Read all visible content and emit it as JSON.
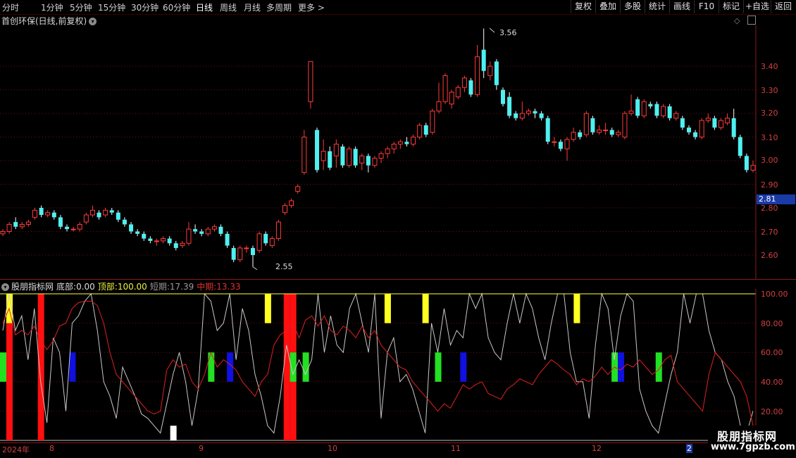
{
  "toolbar": {
    "periods": [
      "分时",
      "1分钟",
      "5分钟",
      "15分钟",
      "30分钟",
      "60分钟",
      "日线",
      "周线",
      "月线",
      "多周期",
      "更多 >"
    ],
    "active_period": "日线",
    "buttons": [
      "复权",
      "叠加",
      "多股",
      "统计",
      "画线",
      "F10",
      "标记",
      "+自选",
      "返回"
    ]
  },
  "main_chart": {
    "title": "首创环保(日线,前复权)",
    "y_ticks": [
      "3.40",
      "3.30",
      "3.20",
      "3.10",
      "3.00",
      "2.90",
      "2.80",
      "2.70",
      "2.60"
    ],
    "current_price": "2.81",
    "high_label": "3.56",
    "low_label": "2.55"
  },
  "indicator": {
    "name": "股朋指标网",
    "bottom_label": "底部:",
    "bottom_value": "0.00",
    "top_label": "顶部:",
    "top_value": "100.00",
    "short_label": "短期:",
    "short_value": "17.39",
    "mid_label": "中期:",
    "mid_value": "13.33",
    "y_ticks": [
      "100.00",
      "80.00",
      "60.00",
      "40.00",
      "20.00"
    ]
  },
  "x_axis": {
    "labels": [
      "2024年",
      "8",
      "9",
      "10",
      "11",
      "12",
      "2"
    ]
  },
  "watermark": {
    "line1": "股朋指标网",
    "line2": "www.7gpzb.com"
  },
  "colors": {
    "up": "#ff3b3b",
    "down": "#4ff0f0",
    "grid": "#8a1a1a",
    "top_line": "#ffff40",
    "short_line": "#c8c8c8",
    "mid_line": "#e02020"
  },
  "chart_data": {
    "type": "candlestick",
    "title": "首创环保(日线,前复权)",
    "ylim": [
      2.52,
      3.6
    ],
    "candles": [
      {
        "o": 2.69,
        "c": 2.7,
        "h": 2.71,
        "l": 2.68
      },
      {
        "o": 2.7,
        "c": 2.73,
        "h": 2.74,
        "l": 2.69
      },
      {
        "o": 2.74,
        "c": 2.72,
        "h": 2.76,
        "l": 2.71
      },
      {
        "o": 2.72,
        "c": 2.73,
        "h": 2.74,
        "l": 2.71
      },
      {
        "o": 2.73,
        "c": 2.74,
        "h": 2.75,
        "l": 2.72
      },
      {
        "o": 2.76,
        "c": 2.79,
        "h": 2.8,
        "l": 2.75
      },
      {
        "o": 2.8,
        "c": 2.77,
        "h": 2.81,
        "l": 2.76
      },
      {
        "o": 2.77,
        "c": 2.78,
        "h": 2.79,
        "l": 2.76
      },
      {
        "o": 2.78,
        "c": 2.76,
        "h": 2.79,
        "l": 2.75
      },
      {
        "o": 2.76,
        "c": 2.72,
        "h": 2.77,
        "l": 2.71
      },
      {
        "o": 2.72,
        "c": 2.71,
        "h": 2.73,
        "l": 2.7
      },
      {
        "o": 2.71,
        "c": 2.71,
        "h": 2.72,
        "l": 2.7
      },
      {
        "o": 2.71,
        "c": 2.73,
        "h": 2.74,
        "l": 2.7
      },
      {
        "o": 2.74,
        "c": 2.77,
        "h": 2.78,
        "l": 2.73
      },
      {
        "o": 2.77,
        "c": 2.79,
        "h": 2.81,
        "l": 2.76
      },
      {
        "o": 2.78,
        "c": 2.76,
        "h": 2.79,
        "l": 2.75
      },
      {
        "o": 2.77,
        "c": 2.79,
        "h": 2.8,
        "l": 2.76
      },
      {
        "o": 2.79,
        "c": 2.78,
        "h": 2.8,
        "l": 2.77
      },
      {
        "o": 2.78,
        "c": 2.75,
        "h": 2.79,
        "l": 2.74
      },
      {
        "o": 2.75,
        "c": 2.73,
        "h": 2.76,
        "l": 2.72
      },
      {
        "o": 2.73,
        "c": 2.7,
        "h": 2.74,
        "l": 2.69
      },
      {
        "o": 2.7,
        "c": 2.69,
        "h": 2.71,
        "l": 2.68
      },
      {
        "o": 2.69,
        "c": 2.67,
        "h": 2.7,
        "l": 2.66
      },
      {
        "o": 2.67,
        "c": 2.66,
        "h": 2.68,
        "l": 2.65
      },
      {
        "o": 2.66,
        "c": 2.66,
        "h": 2.67,
        "l": 2.64
      },
      {
        "o": 2.66,
        "c": 2.67,
        "h": 2.68,
        "l": 2.65
      },
      {
        "o": 2.67,
        "c": 2.65,
        "h": 2.68,
        "l": 2.64
      },
      {
        "o": 2.65,
        "c": 2.63,
        "h": 2.66,
        "l": 2.62
      },
      {
        "o": 2.64,
        "c": 2.65,
        "h": 2.66,
        "l": 2.63
      },
      {
        "o": 2.65,
        "c": 2.71,
        "h": 2.74,
        "l": 2.64
      },
      {
        "o": 2.71,
        "c": 2.7,
        "h": 2.73,
        "l": 2.69
      },
      {
        "o": 2.7,
        "c": 2.69,
        "h": 2.71,
        "l": 2.68
      },
      {
        "o": 2.69,
        "c": 2.71,
        "h": 2.72,
        "l": 2.68
      },
      {
        "o": 2.71,
        "c": 2.72,
        "h": 2.73,
        "l": 2.7
      },
      {
        "o": 2.72,
        "c": 2.69,
        "h": 2.73,
        "l": 2.68
      },
      {
        "o": 2.69,
        "c": 2.64,
        "h": 2.7,
        "l": 2.63
      },
      {
        "o": 2.63,
        "c": 2.58,
        "h": 2.64,
        "l": 2.57
      },
      {
        "o": 2.58,
        "c": 2.63,
        "h": 2.64,
        "l": 2.57
      },
      {
        "o": 2.63,
        "c": 2.63,
        "h": 2.64,
        "l": 2.61
      },
      {
        "o": 2.63,
        "c": 2.6,
        "h": 2.64,
        "l": 2.55
      },
      {
        "o": 2.62,
        "c": 2.69,
        "h": 2.7,
        "l": 2.61
      },
      {
        "o": 2.69,
        "c": 2.65,
        "h": 2.7,
        "l": 2.64
      },
      {
        "o": 2.64,
        "c": 2.67,
        "h": 2.68,
        "l": 2.63
      },
      {
        "o": 2.67,
        "c": 2.74,
        "h": 2.75,
        "l": 2.66
      },
      {
        "o": 2.78,
        "c": 2.81,
        "h": 2.82,
        "l": 2.77
      },
      {
        "o": 2.81,
        "c": 2.83,
        "h": 2.84,
        "l": 2.8
      },
      {
        "o": 2.87,
        "c": 2.89,
        "h": 2.9,
        "l": 2.86
      },
      {
        "o": 2.95,
        "c": 3.1,
        "h": 3.13,
        "l": 2.94
      },
      {
        "o": 3.25,
        "c": 3.42,
        "h": 3.42,
        "l": 3.22
      },
      {
        "o": 3.13,
        "c": 2.96,
        "h": 3.14,
        "l": 2.95
      },
      {
        "o": 3.0,
        "c": 3.04,
        "h": 3.09,
        "l": 2.96
      },
      {
        "o": 3.04,
        "c": 2.97,
        "h": 3.06,
        "l": 2.96
      },
      {
        "o": 3.02,
        "c": 3.07,
        "h": 3.09,
        "l": 2.97
      },
      {
        "o": 3.06,
        "c": 2.98,
        "h": 3.07,
        "l": 2.97
      },
      {
        "o": 2.98,
        "c": 3.05,
        "h": 3.06,
        "l": 2.97
      },
      {
        "o": 3.05,
        "c": 2.98,
        "h": 3.06,
        "l": 2.97
      },
      {
        "o": 2.99,
        "c": 3.02,
        "h": 3.03,
        "l": 2.96
      },
      {
        "o": 3.02,
        "c": 2.98,
        "h": 3.03,
        "l": 2.95
      },
      {
        "o": 2.98,
        "c": 3.01,
        "h": 3.02,
        "l": 2.97
      },
      {
        "o": 3.01,
        "c": 3.03,
        "h": 3.04,
        "l": 2.99
      },
      {
        "o": 3.03,
        "c": 3.05,
        "h": 3.06,
        "l": 3.01
      },
      {
        "o": 3.05,
        "c": 3.07,
        "h": 3.08,
        "l": 3.03
      },
      {
        "o": 3.07,
        "c": 3.08,
        "h": 3.09,
        "l": 3.05
      },
      {
        "o": 3.08,
        "c": 3.07,
        "h": 3.1,
        "l": 3.06
      },
      {
        "o": 3.07,
        "c": 3.1,
        "h": 3.11,
        "l": 3.06
      },
      {
        "o": 3.1,
        "c": 3.15,
        "h": 3.16,
        "l": 3.09
      },
      {
        "o": 3.15,
        "c": 3.11,
        "h": 3.16,
        "l": 3.1
      },
      {
        "o": 3.12,
        "c": 3.21,
        "h": 3.22,
        "l": 3.11
      },
      {
        "o": 3.21,
        "c": 3.25,
        "h": 3.33,
        "l": 3.2
      },
      {
        "o": 3.25,
        "c": 3.36,
        "h": 3.37,
        "l": 3.24
      },
      {
        "o": 3.24,
        "c": 3.29,
        "h": 3.3,
        "l": 3.22
      },
      {
        "o": 3.27,
        "c": 3.31,
        "h": 3.32,
        "l": 3.26
      },
      {
        "o": 3.31,
        "c": 3.35,
        "h": 3.36,
        "l": 3.29
      },
      {
        "o": 3.34,
        "c": 3.28,
        "h": 3.35,
        "l": 3.27
      },
      {
        "o": 3.28,
        "c": 3.44,
        "h": 3.49,
        "l": 3.27
      },
      {
        "o": 3.47,
        "c": 3.38,
        "h": 3.56,
        "l": 3.35
      },
      {
        "o": 3.36,
        "c": 3.4,
        "h": 3.42,
        "l": 3.34
      },
      {
        "o": 3.42,
        "c": 3.32,
        "h": 3.43,
        "l": 3.3
      },
      {
        "o": 3.3,
        "c": 3.24,
        "h": 3.31,
        "l": 3.23
      },
      {
        "o": 3.27,
        "c": 3.19,
        "h": 3.29,
        "l": 3.18
      },
      {
        "o": 3.2,
        "c": 3.18,
        "h": 3.21,
        "l": 3.17
      },
      {
        "o": 3.18,
        "c": 3.2,
        "h": 3.25,
        "l": 3.17
      },
      {
        "o": 3.2,
        "c": 3.21,
        "h": 3.22,
        "l": 3.19
      },
      {
        "o": 3.21,
        "c": 3.2,
        "h": 3.22,
        "l": 3.18
      },
      {
        "o": 3.2,
        "c": 3.18,
        "h": 3.21,
        "l": 3.17
      },
      {
        "o": 3.18,
        "c": 3.08,
        "h": 3.19,
        "l": 3.07
      },
      {
        "o": 3.08,
        "c": 3.08,
        "h": 3.1,
        "l": 3.06
      },
      {
        "o": 3.08,
        "c": 3.05,
        "h": 3.09,
        "l": 3.04
      },
      {
        "o": 3.05,
        "c": 3.09,
        "h": 3.1,
        "l": 3.0
      },
      {
        "o": 3.09,
        "c": 3.12,
        "h": 3.14,
        "l": 3.08
      },
      {
        "o": 3.12,
        "c": 3.1,
        "h": 3.13,
        "l": 3.09
      },
      {
        "o": 3.11,
        "c": 3.2,
        "h": 3.21,
        "l": 3.1
      },
      {
        "o": 3.18,
        "c": 3.12,
        "h": 3.19,
        "l": 3.11
      },
      {
        "o": 3.12,
        "c": 3.13,
        "h": 3.15,
        "l": 3.11
      },
      {
        "o": 3.13,
        "c": 3.13,
        "h": 3.16,
        "l": 3.11
      },
      {
        "o": 3.13,
        "c": 3.11,
        "h": 3.14,
        "l": 3.1
      },
      {
        "o": 3.11,
        "c": 3.12,
        "h": 3.13,
        "l": 3.1
      },
      {
        "o": 3.1,
        "c": 3.2,
        "h": 3.21,
        "l": 3.09
      },
      {
        "o": 3.2,
        "c": 3.21,
        "h": 3.28,
        "l": 3.19
      },
      {
        "o": 3.26,
        "c": 3.19,
        "h": 3.27,
        "l": 3.18
      },
      {
        "o": 3.19,
        "c": 3.25,
        "h": 3.26,
        "l": 3.18
      },
      {
        "o": 3.24,
        "c": 3.23,
        "h": 3.25,
        "l": 3.22
      },
      {
        "o": 3.24,
        "c": 3.19,
        "h": 3.25,
        "l": 3.18
      },
      {
        "o": 3.19,
        "c": 3.23,
        "h": 3.24,
        "l": 3.18
      },
      {
        "o": 3.23,
        "c": 3.18,
        "h": 3.24,
        "l": 3.17
      },
      {
        "o": 3.18,
        "c": 3.2,
        "h": 3.21,
        "l": 3.17
      },
      {
        "o": 3.18,
        "c": 3.14,
        "h": 3.19,
        "l": 3.13
      },
      {
        "o": 3.14,
        "c": 3.12,
        "h": 3.15,
        "l": 3.11
      },
      {
        "o": 3.12,
        "c": 3.1,
        "h": 3.13,
        "l": 3.09
      },
      {
        "o": 3.1,
        "c": 3.17,
        "h": 3.18,
        "l": 3.09
      },
      {
        "o": 3.17,
        "c": 3.18,
        "h": 3.2,
        "l": 3.16
      },
      {
        "o": 3.18,
        "c": 3.14,
        "h": 3.19,
        "l": 3.13
      },
      {
        "o": 3.14,
        "c": 3.17,
        "h": 3.18,
        "l": 3.13
      },
      {
        "o": 3.16,
        "c": 3.18,
        "h": 3.2,
        "l": 3.15
      },
      {
        "o": 3.18,
        "c": 3.1,
        "h": 3.22,
        "l": 3.09
      },
      {
        "o": 3.1,
        "c": 3.02,
        "h": 3.11,
        "l": 3.01
      },
      {
        "o": 3.02,
        "c": 2.96,
        "h": 3.03,
        "l": 2.95
      },
      {
        "o": 2.96,
        "c": 2.98,
        "h": 3.0,
        "l": 2.95
      }
    ],
    "indicator_ylim": [
      0,
      100
    ],
    "short": [
      75,
      100,
      75,
      85,
      55,
      90,
      40,
      12,
      70,
      60,
      20,
      80,
      85,
      95,
      100,
      75,
      40,
      30,
      15,
      50,
      40,
      30,
      18,
      15,
      10,
      5,
      25,
      45,
      60,
      40,
      10,
      35,
      100,
      95,
      75,
      80,
      100,
      55,
      90,
      75,
      45,
      30,
      10,
      5,
      30,
      65,
      45,
      55,
      45,
      55,
      100,
      60,
      85,
      65,
      60,
      90,
      100,
      80,
      60,
      100,
      15,
      60,
      70,
      40,
      45,
      35,
      20,
      5,
      80,
      60,
      90,
      65,
      75,
      70,
      100,
      90,
      100,
      70,
      60,
      55,
      80,
      100,
      80,
      100,
      90,
      70,
      55,
      80,
      100,
      100,
      60,
      40,
      40,
      15,
      65,
      100,
      90,
      55,
      85,
      100,
      95,
      35,
      20,
      10,
      5,
      25,
      45,
      60,
      100,
      80,
      100,
      100,
      75,
      60,
      55,
      40,
      30,
      10,
      5,
      20
    ],
    "mid": [
      80,
      90,
      72,
      75,
      72,
      78,
      68,
      62,
      68,
      78,
      80,
      90,
      94,
      95,
      95,
      92,
      80,
      60,
      45,
      40,
      35,
      30,
      25,
      20,
      18,
      20,
      48,
      55,
      50,
      52,
      40,
      35,
      45,
      60,
      50,
      55,
      52,
      48,
      40,
      35,
      30,
      40,
      45,
      65,
      72,
      75,
      80,
      70,
      82,
      85,
      78,
      85,
      75,
      72,
      78,
      75,
      70,
      78,
      70,
      75,
      65,
      60,
      55,
      50,
      48,
      40,
      35,
      30,
      25,
      20,
      25,
      22,
      30,
      38,
      35,
      38,
      40,
      32,
      30,
      28,
      35,
      38,
      42,
      40,
      38,
      45,
      50,
      55,
      52,
      48,
      45,
      38,
      42,
      40,
      44,
      50,
      45,
      50,
      48,
      52,
      50,
      55,
      50,
      45,
      48,
      55,
      58,
      40,
      35,
      30,
      25,
      20,
      45,
      60,
      55,
      50,
      45,
      40,
      30,
      10
    ]
  }
}
